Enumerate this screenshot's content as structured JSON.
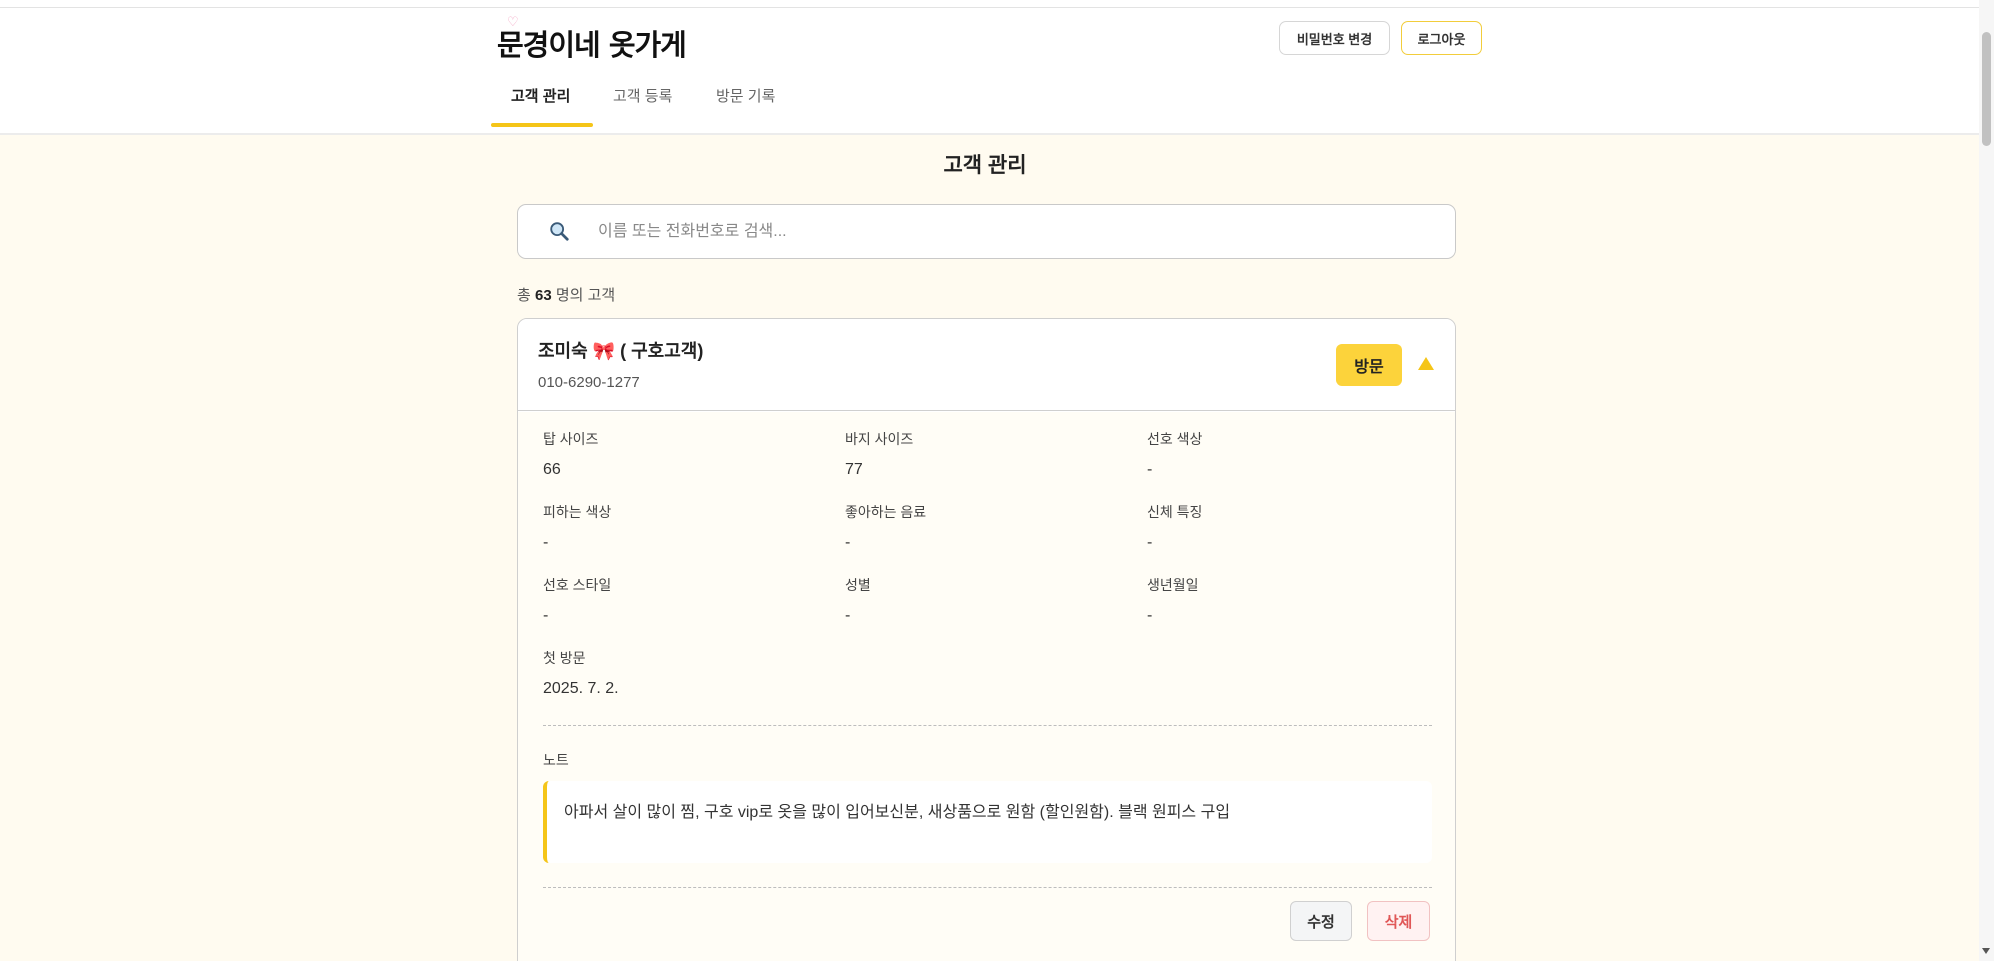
{
  "header": {
    "logo_text": "문경이네 옷가게",
    "change_password_label": "비밀번호 변경",
    "logout_label": "로그아웃",
    "tabs": [
      {
        "label": "고객 관리",
        "active": true
      },
      {
        "label": "고객 등록",
        "active": false
      },
      {
        "label": "방문 기록",
        "active": false
      }
    ]
  },
  "main": {
    "title": "고객 관리",
    "search": {
      "placeholder": "이름 또는 전화번호로 검색...",
      "value": "",
      "icon": "magnifier-icon"
    },
    "count": {
      "prefix": "총",
      "number": "63",
      "suffix": "명의 고객"
    }
  },
  "customer": {
    "name": "조미숙 🎀 ( 구호고객)",
    "phone": "010-6290-1277",
    "visit_label": "방문",
    "expanded": true,
    "fields": [
      {
        "label": "탑 사이즈",
        "value": "66"
      },
      {
        "label": "바지 사이즈",
        "value": "77"
      },
      {
        "label": "선호 색상",
        "value": "-"
      },
      {
        "label": "피하는 색상",
        "value": "-"
      },
      {
        "label": "좋아하는 음료",
        "value": "-"
      },
      {
        "label": "신체 특징",
        "value": "-"
      },
      {
        "label": "선호 스타일",
        "value": "-"
      },
      {
        "label": "성별",
        "value": "-"
      },
      {
        "label": "생년월일",
        "value": "-"
      },
      {
        "label": "첫 방문",
        "value": "2025. 7. 2."
      }
    ],
    "note_label": "노트",
    "note": "아파서 살이 많이 찜, 구호 vip로 옷을 많이 입어보신분, 새상품으로 원함 (할인원함). 블랙 원피스 구입",
    "edit_label": "수정",
    "delete_label": "삭제"
  },
  "colors": {
    "accent": "#f5c518",
    "button_yellow": "#fcd33b",
    "background": "#fffbf0",
    "delete_red": "#e05757"
  }
}
